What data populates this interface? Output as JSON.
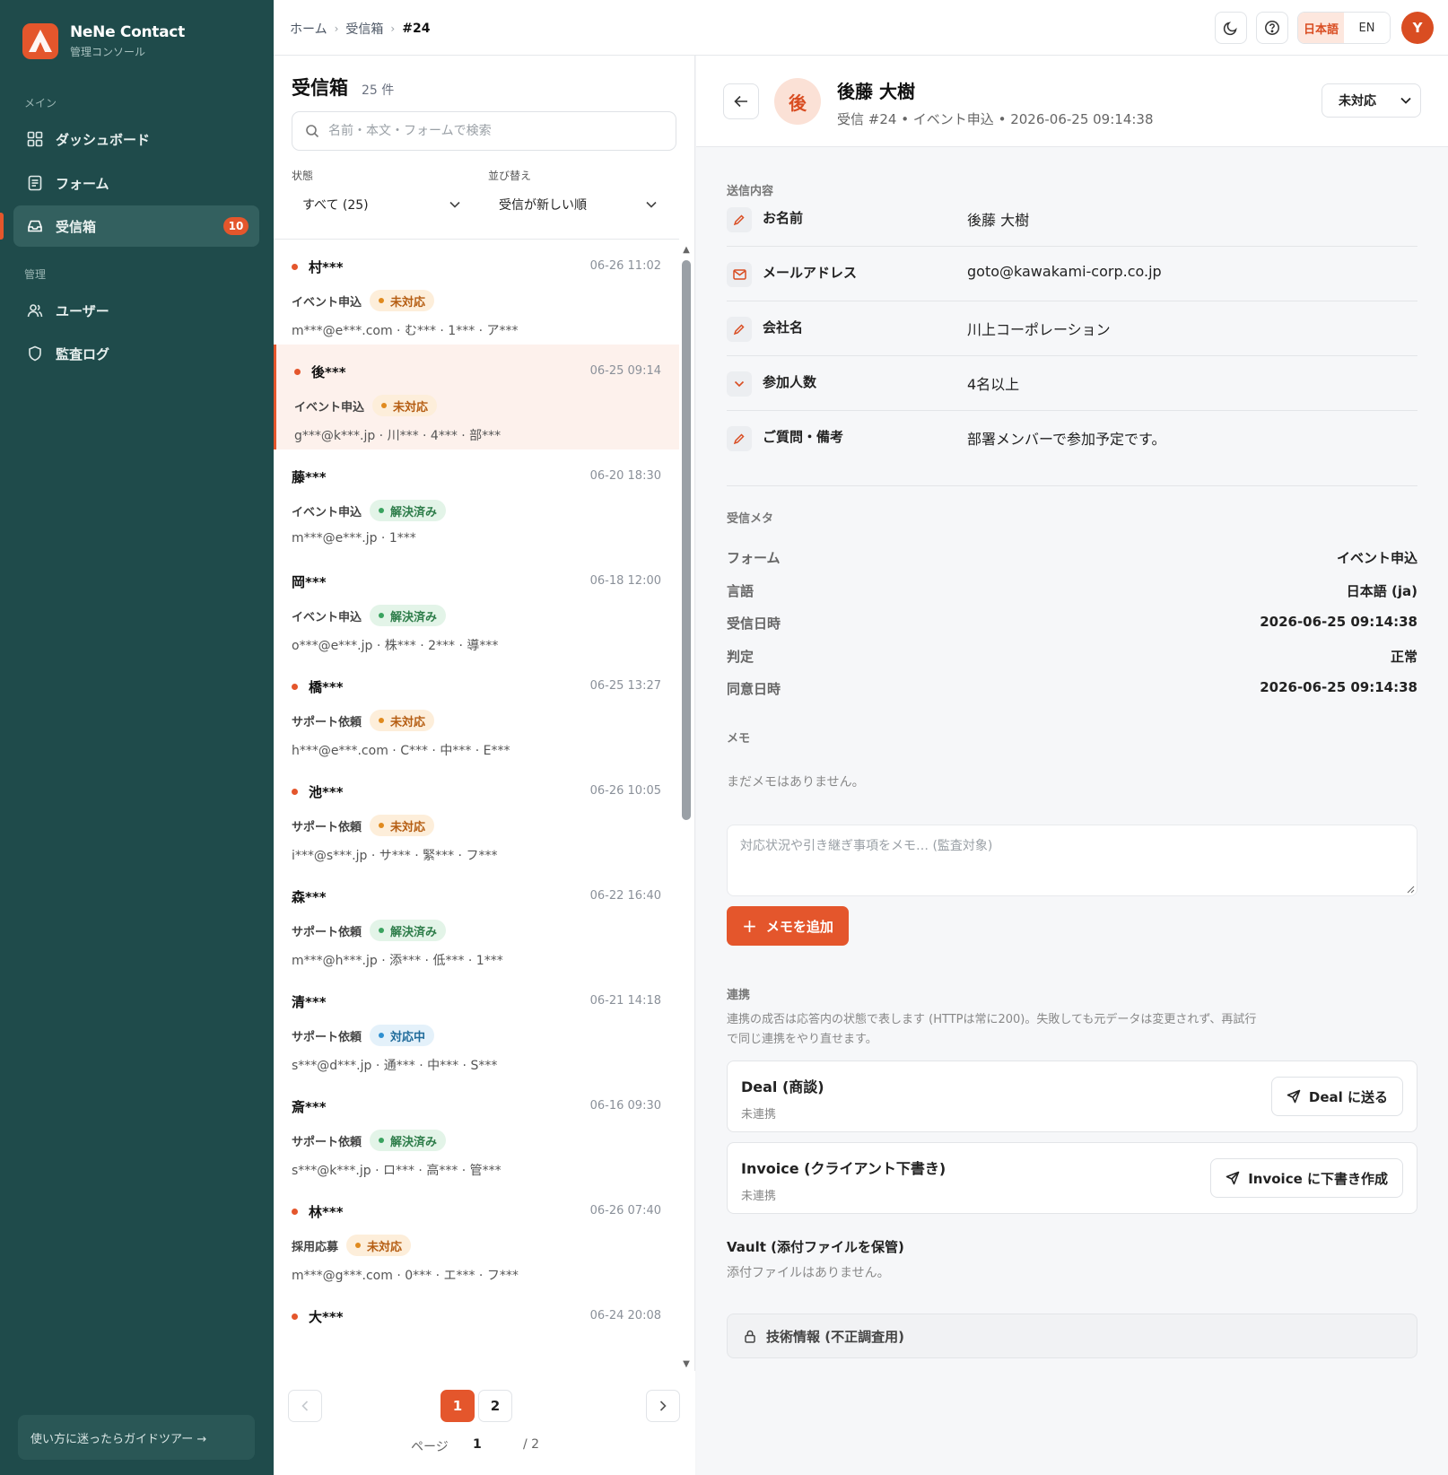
{
  "brand": {
    "name": "NeNe Contact",
    "subtitle": "管理コンソール"
  },
  "sidebar": {
    "section_main": "メイン",
    "section_admin": "管理",
    "items": [
      {
        "label": "ダッシュボード",
        "icon": "dashboard-icon"
      },
      {
        "label": "フォーム",
        "icon": "form-icon"
      },
      {
        "label": "受信箱",
        "icon": "inbox-icon",
        "badge": "10",
        "active": true
      },
      {
        "label": "ユーザー",
        "icon": "users-icon"
      },
      {
        "label": "監査ログ",
        "icon": "shield-icon"
      }
    ],
    "guide": "使い方に迷ったらガイドツアー →"
  },
  "topbar": {
    "breadcrumb": [
      "ホーム",
      "受信箱",
      "#24"
    ],
    "lang_ja": "日本語",
    "lang_en": "EN",
    "avatar": "Y"
  },
  "inbox": {
    "title": "受信箱",
    "count": "25 件",
    "search_placeholder": "名前・本文・フォームで検索",
    "filter_status_label": "状態",
    "filter_status_value": "すべて (25)",
    "sort_label": "並び替え",
    "sort_value": "受信が新しい順",
    "rows": [
      {
        "name": "村***",
        "unread": true,
        "time": "06-26 11:02",
        "form": "イベント申込",
        "status": "未対応",
        "status_type": "pending",
        "summary": "m***@e***.com · む*** · 1*** · ア***"
      },
      {
        "name": "後***",
        "unread": true,
        "time": "06-25 09:14",
        "form": "イベント申込",
        "status": "未対応",
        "status_type": "pending",
        "summary": "g***@k***.jp · 川*** · 4*** · 部***",
        "selected": true
      },
      {
        "name": "藤***",
        "unread": false,
        "time": "06-20 18:30",
        "form": "イベント申込",
        "status": "解決済み",
        "status_type": "resolved",
        "summary": "m***@e***.jp · 1***"
      },
      {
        "name": "岡***",
        "unread": false,
        "time": "06-18 12:00",
        "form": "イベント申込",
        "status": "解決済み",
        "status_type": "resolved",
        "summary": "o***@e***.jp · 株*** · 2*** · 導***"
      },
      {
        "name": "橋***",
        "unread": true,
        "time": "06-25 13:27",
        "form": "サポート依頼",
        "status": "未対応",
        "status_type": "pending",
        "summary": "h***@e***.com · C*** · 中*** · E***"
      },
      {
        "name": "池***",
        "unread": true,
        "time": "06-26 10:05",
        "form": "サポート依頼",
        "status": "未対応",
        "status_type": "pending",
        "summary": "i***@s***.jp · サ*** · 緊*** · フ***"
      },
      {
        "name": "森***",
        "unread": false,
        "time": "06-22 16:40",
        "form": "サポート依頼",
        "status": "解決済み",
        "status_type": "resolved",
        "summary": "m***@h***.jp · 添*** · 低*** · 1***"
      },
      {
        "name": "清***",
        "unread": false,
        "time": "06-21 14:18",
        "form": "サポート依頼",
        "status": "対応中",
        "status_type": "progress",
        "summary": "s***@d***.jp · 通*** · 中*** · S***"
      },
      {
        "name": "斎***",
        "unread": false,
        "time": "06-16 09:30",
        "form": "サポート依頼",
        "status": "解決済み",
        "status_type": "resolved",
        "summary": "s***@k***.jp · ロ*** · 高*** · 管***"
      },
      {
        "name": "林***",
        "unread": true,
        "time": "06-26 07:40",
        "form": "採用応募",
        "status": "未対応",
        "status_type": "pending",
        "summary": "m***@g***.com · 0*** · エ*** · フ***"
      },
      {
        "name": "大***",
        "unread": true,
        "time": "06-24 20:08",
        "form": "",
        "status": "",
        "status_type": "",
        "summary": ""
      }
    ],
    "pagination": {
      "pages": [
        "1",
        "2"
      ],
      "current": "1",
      "page_label": "ページ",
      "page_value": "1",
      "total": "/ 2"
    }
  },
  "detail": {
    "avatar": "後",
    "name": "後藤 大樹",
    "subtitle": "受信 #24 • イベント申込 • 2026-06-25 09:14:38",
    "status": "未対応",
    "content_label": "送信内容",
    "fields": [
      {
        "key": "お名前",
        "value": "後藤 大樹",
        "icon": "pencil-icon"
      },
      {
        "key": "メールアドレス",
        "value": "goto@kawakami-corp.co.jp",
        "icon": "mail-icon"
      },
      {
        "key": "会社名",
        "value": "川上コーポレーション",
        "icon": "pencil-icon"
      },
      {
        "key": "参加人数",
        "value": "4名以上",
        "icon": "chevron-down-icon"
      },
      {
        "key": "ご質問・備考",
        "value": "部署メンバーで参加予定です。",
        "icon": "pencil-icon"
      }
    ],
    "meta_label": "受信メタ",
    "meta": [
      {
        "key": "フォーム",
        "value": "イベント申込"
      },
      {
        "key": "言語",
        "value": "日本語 (ja)"
      },
      {
        "key": "受信日時",
        "value": "2026-06-25 09:14:38"
      },
      {
        "key": "判定",
        "value": "正常"
      },
      {
        "key": "同意日時",
        "value": "2026-06-25 09:14:38"
      }
    ],
    "memo_label": "メモ",
    "memo_empty": "まだメモはありません。",
    "memo_placeholder": "対応状況や引き継ぎ事項をメモ… (監査対象)",
    "memo_add": "メモを追加",
    "integration_label": "連携",
    "integration_desc": "連携の成否は応答内の状態で表します (HTTPは常に200)。失敗しても元データは変更されず、再試行で同じ連携をやり直せます。",
    "integrations": [
      {
        "title": "Deal (商談)",
        "status": "未連携",
        "button": "Deal に送る"
      },
      {
        "title": "Invoice (クライアント下書き)",
        "status": "未連携",
        "button": "Invoice に下書き作成"
      }
    ],
    "vault_title": "Vault (添付ファイルを保管)",
    "vault_empty": "添付ファイルはありません。",
    "tech_info": "技術情報 (不正調査用)"
  },
  "colors": {
    "accent": "#e4562c",
    "sidebar": "#1f4b4b",
    "pending": "#e08a1e",
    "resolved": "#3aa35f",
    "progress": "#2f8fd0"
  }
}
